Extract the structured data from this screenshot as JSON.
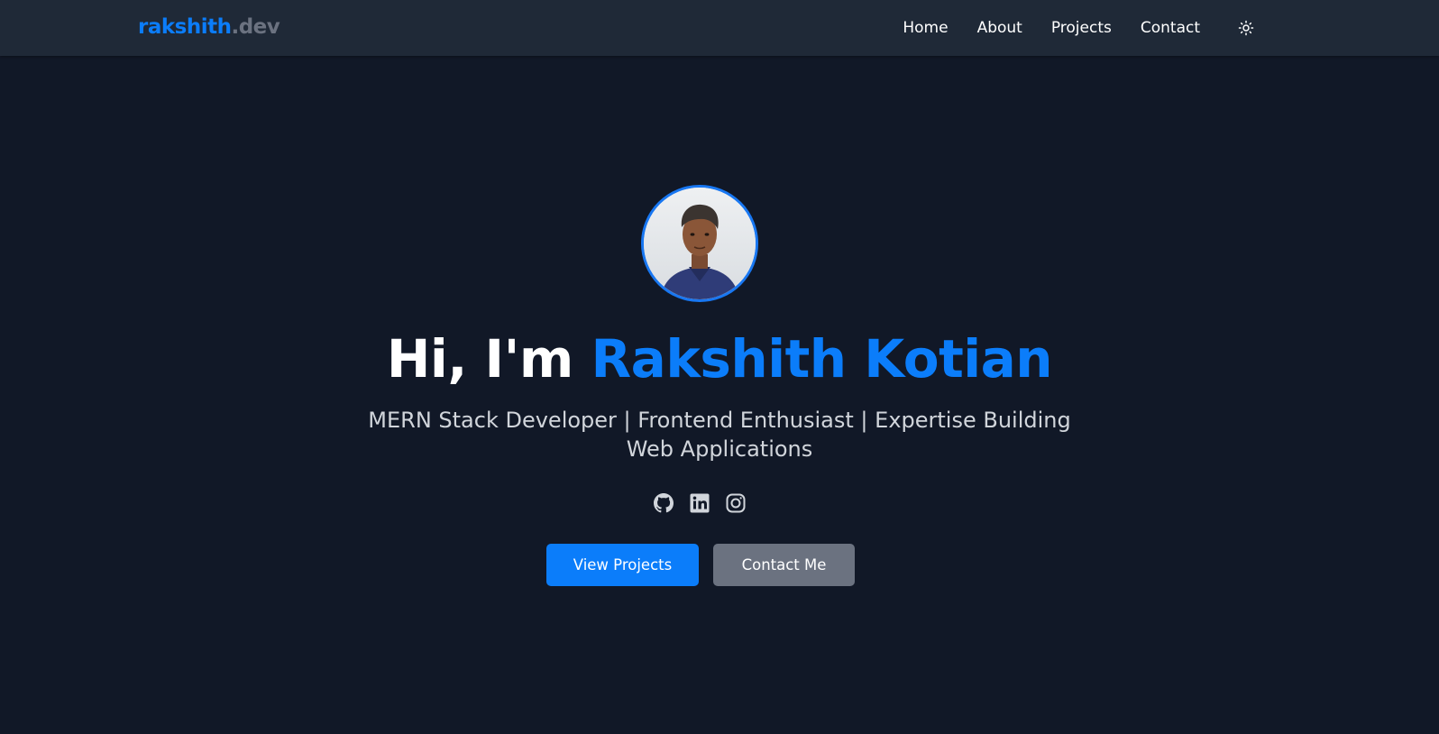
{
  "navbar": {
    "brand_name": "rakshith",
    "brand_tld": ".dev",
    "links": [
      {
        "label": "Home"
      },
      {
        "label": "About"
      },
      {
        "label": "Projects"
      },
      {
        "label": "Contact"
      }
    ],
    "theme_toggle_icon": "sun-icon"
  },
  "hero": {
    "avatar_icon": "profile-photo",
    "greeting": "Hi, I'm ",
    "name": "Rakshith Kotian",
    "tagline": "MERN Stack Developer | Frontend Enthusiast | Expertise Building Web Applications",
    "socials": [
      {
        "icon": "github-icon"
      },
      {
        "icon": "linkedin-icon"
      },
      {
        "icon": "instagram-icon"
      }
    ],
    "buttons": {
      "primary": "View Projects",
      "secondary": "Contact Me"
    }
  },
  "colors": {
    "background": "#111827",
    "navbar": "#1f2937",
    "accent": "#0b7dfa",
    "muted": "#6b7280",
    "tagline": "#d1d5db"
  }
}
